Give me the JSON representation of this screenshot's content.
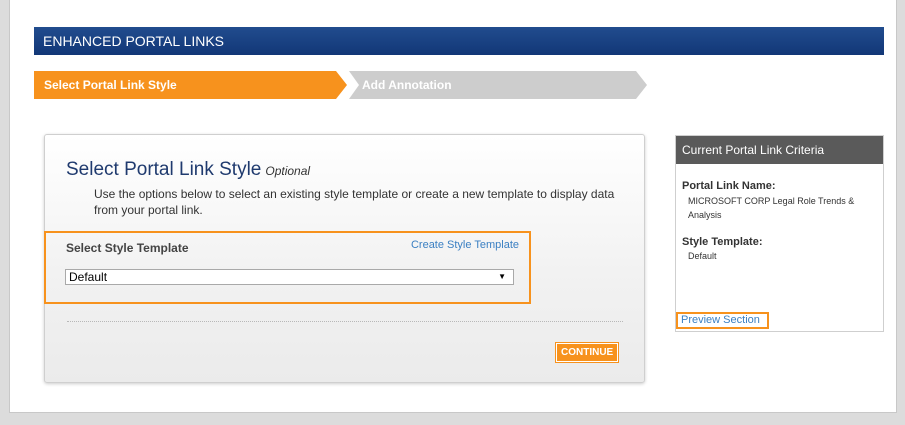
{
  "header": {
    "title": "ENHANCED PORTAL LINKS"
  },
  "steps": [
    {
      "label": "Select Portal Link Style",
      "state": "active"
    },
    {
      "label": "Add Annotation",
      "state": "inactive"
    }
  ],
  "form": {
    "title": "Select Portal Link Style",
    "optional_label": "Optional",
    "description": "Use the options below to select an existing style template or create a new template to display data from your portal link.",
    "template_label": "Select Style Template",
    "create_link": "Create Style Template",
    "selected_template": "Default",
    "continue_label": "CONTINUE"
  },
  "criteria": {
    "header": "Current Portal Link Criteria",
    "name_label": "Portal Link Name:",
    "name_value": "MICROSOFT CORP Legal Role Trends & Analysis",
    "style_label": "Style Template:",
    "style_value": "Default",
    "preview_link": "Preview Section"
  },
  "colors": {
    "accent": "#f7921d",
    "banner": "#1a3f80",
    "link": "#3a7fc2"
  }
}
